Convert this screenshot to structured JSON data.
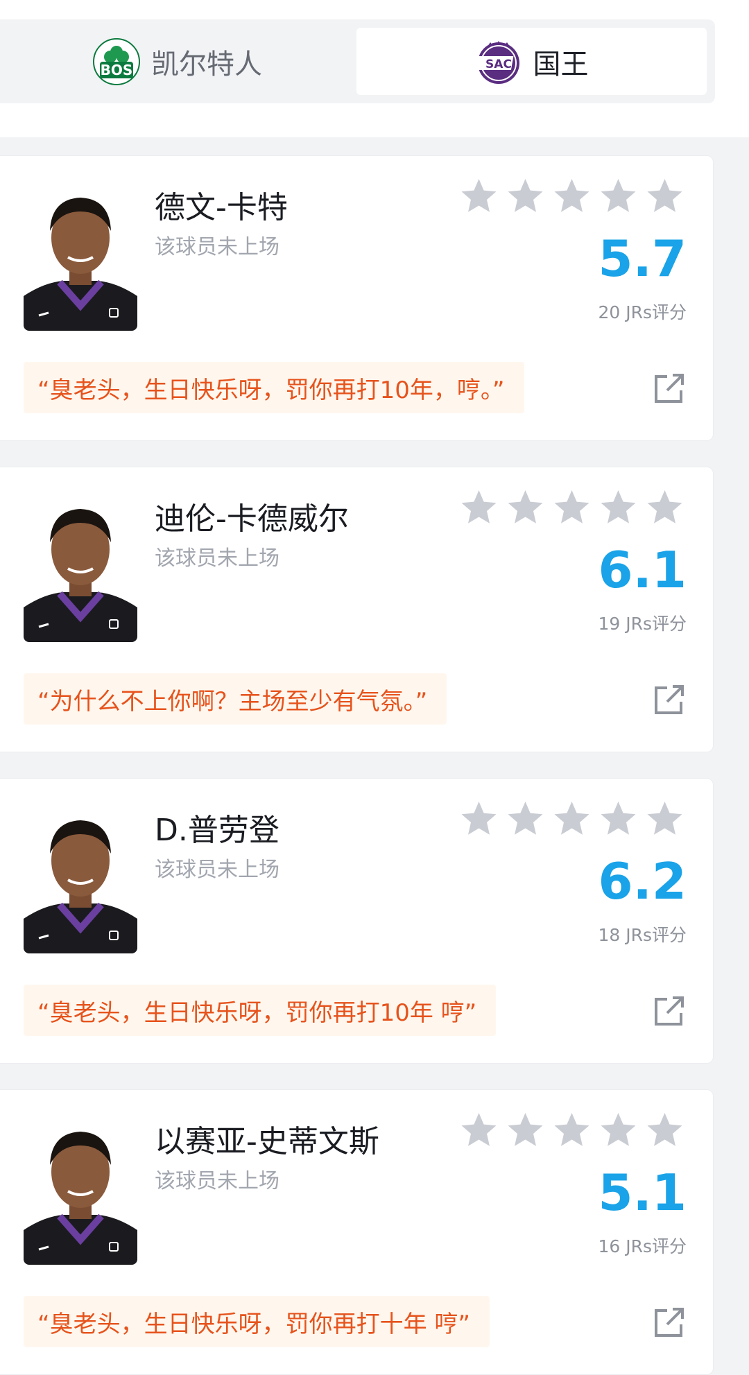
{
  "tabs": {
    "away": {
      "label": "凯尔特人",
      "logo_text": "BOS",
      "color": "#0b7a3e"
    },
    "home": {
      "label": "国王",
      "logo_text": "SAC",
      "color": "#5a2d81",
      "selected": true
    }
  },
  "players": [
    {
      "name": "德文-卡特",
      "status": "该球员未上场",
      "score": "5.7",
      "votes": "20 JRs评分",
      "comment": "“臭老头，生日快乐呀，罚你再打10年，哼。”",
      "rating_stars": 0
    },
    {
      "name": "迪伦-卡德威尔",
      "status": "该球员未上场",
      "score": "6.1",
      "votes": "19 JRs评分",
      "comment": "“为什么不上你啊？主场至少有气氛。”",
      "rating_stars": 0
    },
    {
      "name": "D.普劳登",
      "status": "该球员未上场",
      "score": "6.2",
      "votes": "18 JRs评分",
      "comment": "“臭老头，生日快乐呀，罚你再打10年 哼”",
      "rating_stars": 0
    },
    {
      "name": "以赛亚-史蒂文斯",
      "status": "该球员未上场",
      "score": "5.1",
      "votes": "16 JRs评分",
      "comment": "“臭老头，生日快乐呀，罚你再打十年 哼”",
      "rating_stars": 0
    }
  ],
  "colors": {
    "score": "#1aa3e8",
    "comment_text": "#e6531c",
    "comment_bg": "#fff7ee",
    "star_empty": "#c9ccd3",
    "jersey": "#1b1b1f",
    "jersey_trim": "#6b3fa0"
  }
}
